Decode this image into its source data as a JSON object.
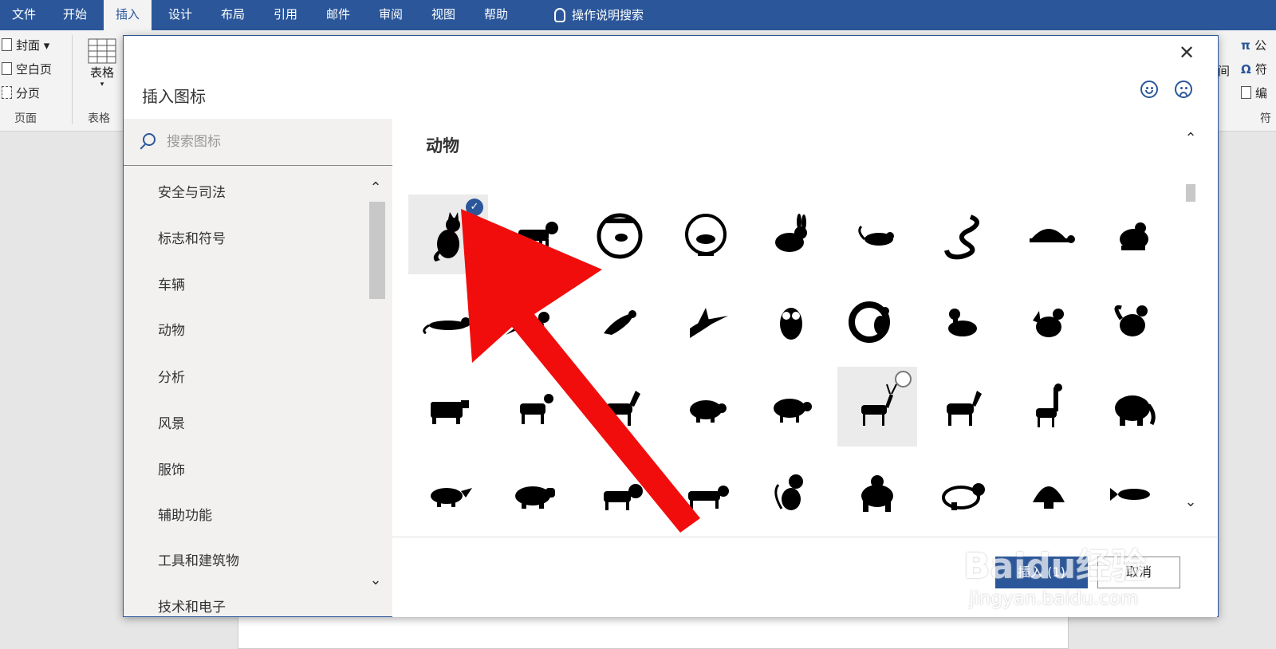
{
  "tabs": [
    "文件",
    "开始",
    "插入",
    "设计",
    "布局",
    "引用",
    "邮件",
    "审阅",
    "视图",
    "帮助"
  ],
  "active_tab_index": 2,
  "tell_me": "操作说明搜索",
  "ribbon": {
    "pages": {
      "cover": "封面",
      "blank": "空白页",
      "break": "分页",
      "group_label": "页面"
    },
    "table": {
      "button": "表格",
      "group_label": "表格"
    },
    "right": {
      "equation": "公",
      "symbol": "符",
      "number": "编",
      "group_label": "符",
      "partial": "间"
    }
  },
  "dialog": {
    "title": "插入图标",
    "close": "✕",
    "search_placeholder": "搜索图标",
    "categories": [
      "安全与司法",
      "标志和符号",
      "车辆",
      "动物",
      "分析",
      "风景",
      "服饰",
      "辅助功能",
      "工具和建筑物",
      "技术和电子"
    ],
    "section_title": "动物",
    "selected_icon": "cat",
    "icons": [
      [
        "cat",
        "dog",
        "fishbowl",
        "hamster-wheel",
        "rabbit",
        "mouse",
        "snake",
        "turtle",
        "frog"
      ],
      [
        "lizard",
        "crow",
        "bird",
        "hummingbird",
        "owl",
        "peacock",
        "duck",
        "hen",
        "rooster"
      ],
      [
        "cow",
        "goat",
        "horse",
        "pig",
        "sheep",
        "deer",
        "zebra",
        "giraffe",
        "elephant"
      ],
      [
        "rhino",
        "hippo",
        "lion",
        "tiger",
        "monkey",
        "gorilla",
        "panda",
        "shell",
        "fish"
      ]
    ],
    "insert_button": "插入 (1)",
    "cancel_button": "取消"
  },
  "watermark": {
    "logo": "Baidu经验",
    "url": "jingyan.baidu.com"
  },
  "colors": {
    "accent": "#2b579a",
    "annotation_arrow": "#f20d0d"
  }
}
